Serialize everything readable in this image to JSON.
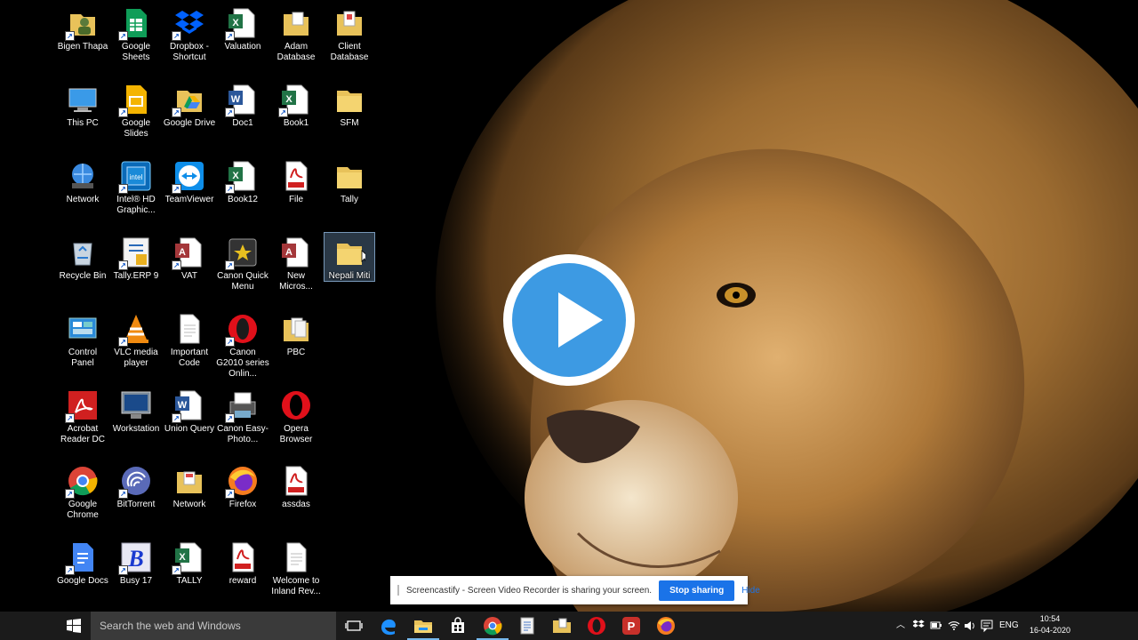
{
  "desktop": {
    "icons": [
      {
        "label": "Bigen Thapa",
        "icon": "user-folder-icon"
      },
      {
        "label": "Google Sheets",
        "icon": "google-sheets-icon"
      },
      {
        "label": "Dropbox - Shortcut",
        "icon": "dropbox-icon"
      },
      {
        "label": "Valuation",
        "icon": "excel-file-icon"
      },
      {
        "label": "Adam Database",
        "icon": "folder-icon"
      },
      {
        "label": "Client Database",
        "icon": "folder-icon"
      },
      {
        "label": "This PC",
        "icon": "computer-icon"
      },
      {
        "label": "Google Slides",
        "icon": "google-slides-icon"
      },
      {
        "label": "Google Drive",
        "icon": "google-drive-icon"
      },
      {
        "label": "Doc1",
        "icon": "word-file-icon"
      },
      {
        "label": "Book1",
        "icon": "excel-file-icon"
      },
      {
        "label": "SFM",
        "icon": "folder-icon"
      },
      {
        "label": "Network",
        "icon": "network-globe-icon"
      },
      {
        "label": "Intel® HD Graphic...",
        "icon": "intel-graphics-icon"
      },
      {
        "label": "TeamViewer",
        "icon": "teamviewer-icon"
      },
      {
        "label": "Book12",
        "icon": "excel-file-icon"
      },
      {
        "label": "File",
        "icon": "pdf-file-icon"
      },
      {
        "label": "Tally",
        "icon": "folder-icon"
      },
      {
        "label": "Recycle Bin",
        "icon": "recycle-bin-icon"
      },
      {
        "label": "Tally.ERP 9",
        "icon": "tally-erp-icon"
      },
      {
        "label": "VAT",
        "icon": "access-file-icon"
      },
      {
        "label": "Canon Quick Menu",
        "icon": "canon-quick-menu-icon"
      },
      {
        "label": "New Micros...",
        "icon": "access-file-icon"
      },
      {
        "label": "Nepali Miti",
        "icon": "folder-icon"
      },
      {
        "label": "Control Panel",
        "icon": "control-panel-icon"
      },
      {
        "label": "VLC media player",
        "icon": "vlc-icon"
      },
      {
        "label": "Important Code",
        "icon": "text-file-icon"
      },
      {
        "label": "Canon G2010 series Onlin...",
        "icon": "opera-icon"
      },
      {
        "label": "PBC",
        "icon": "folder-icon"
      },
      {
        "label": "Acrobat Reader DC",
        "icon": "acrobat-icon"
      },
      {
        "label": "Workstation",
        "icon": "monitor-icon"
      },
      {
        "label": "Union Query",
        "icon": "word-file-icon"
      },
      {
        "label": "Canon Easy-Photo...",
        "icon": "printer-icon"
      },
      {
        "label": "Opera Browser",
        "icon": "opera-icon"
      },
      {
        "label": "Google Chrome",
        "icon": "chrome-icon"
      },
      {
        "label": "BitTorrent",
        "icon": "bittorrent-icon"
      },
      {
        "label": "Network",
        "icon": "folder-icon"
      },
      {
        "label": "Firefox",
        "icon": "firefox-icon"
      },
      {
        "label": "assdas",
        "icon": "pdf-file-icon"
      },
      {
        "label": "Google Docs",
        "icon": "google-docs-icon"
      },
      {
        "label": "Busy 17",
        "icon": "busy-icon"
      },
      {
        "label": "TALLY",
        "icon": "excel-file-icon"
      },
      {
        "label": "reward",
        "icon": "pdf-file-icon"
      },
      {
        "label": "Welcome to Inland Rev...",
        "icon": "text-file-icon"
      }
    ],
    "selected_label": "Nepali Miti"
  },
  "share_bar": {
    "message": "Screencastify - Screen Video Recorder is sharing your screen.",
    "stop_label": "Stop sharing",
    "hide_label": "Hide"
  },
  "taskbar": {
    "search_placeholder": "Search the web and Windows",
    "pinned": [
      "task-view-icon",
      "edge-icon",
      "file-explorer-icon",
      "store-icon",
      "chrome-icon",
      "notepad-icon",
      "folder-icon",
      "opera-icon",
      "wps-icon",
      "firefox-icon"
    ],
    "language": "ENG",
    "time": "10:54",
    "date": "16-04-2020"
  },
  "colors": {
    "taskbar_bg": "#1b1b1b",
    "search_bg": "#3a3a3a",
    "play_blue": "#3d9ae3",
    "share_button_blue": "#1a73e8",
    "selection_blue": "#78a0c8"
  }
}
